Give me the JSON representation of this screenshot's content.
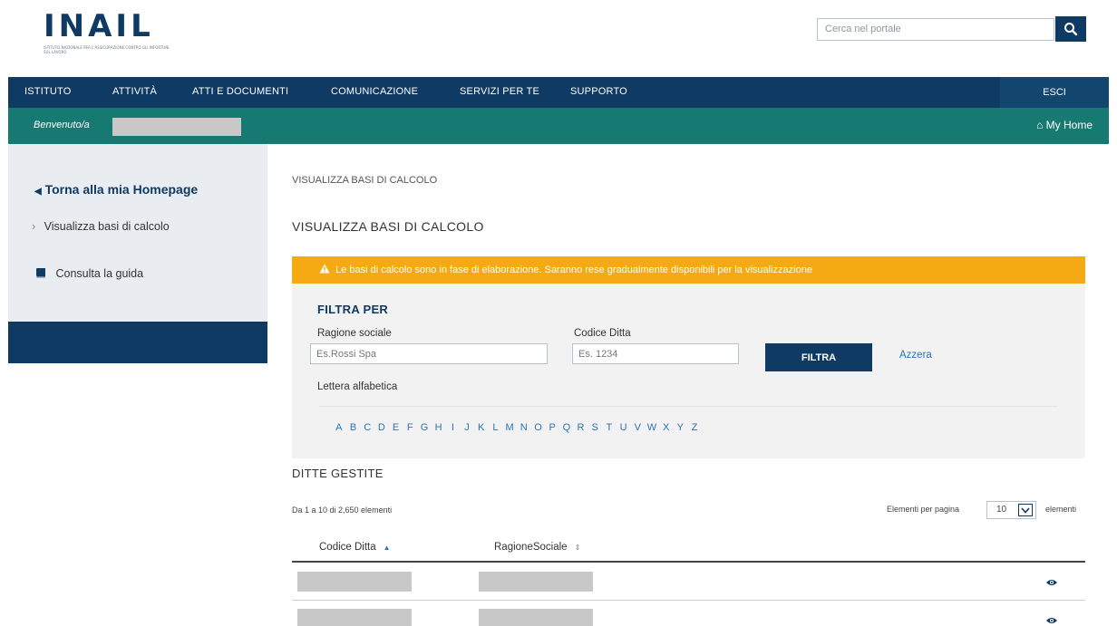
{
  "header": {
    "logo_text": "INAIL",
    "logo_subtitle": "ISTITUTO NAZIONALE PER L'ASSICURAZIONE CONTRO GLI INFORTUNI SUL LAVORO",
    "search_placeholder": "Cerca nel portale"
  },
  "topnav": {
    "items": [
      "ISTITUTO",
      "ATTIVITÀ",
      "ATTI E DOCUMENTI",
      "COMUNICAZIONE",
      "SERVIZI PER TE",
      "SUPPORTO"
    ],
    "logout": "ESCI"
  },
  "welcome": {
    "label": "Benvenuto/a",
    "my_home": "My Home"
  },
  "sidebar": {
    "back_link": "Torna alla mia Homepage",
    "item": "Visualizza basi di calcolo",
    "guide": "Consulta la guida"
  },
  "main": {
    "breadcrumb": "VISUALIZZA BASI DI CALCOLO",
    "title": "VISUALIZZA BASI DI CALCOLO",
    "alert": "Le basi di calcolo sono in fase di elaborazione. Saranno rese gradualmente disponibili per la visualizzazione",
    "filter": {
      "title": "FILTRA PER",
      "ragione_label": "Ragione sociale",
      "ragione_placeholder": "Es.Rossi Spa",
      "codice_label": "Codice Ditta",
      "codice_placeholder": "Es. 1234",
      "filter_button": "FILTRA",
      "reset_link": "Azzera",
      "alpha_label": "Lettera alfabetica",
      "letters": [
        "A",
        "B",
        "C",
        "D",
        "E",
        "F",
        "G",
        "H",
        "I",
        "J",
        "K",
        "L",
        "M",
        "N",
        "O",
        "P",
        "Q",
        "R",
        "S",
        "T",
        "U",
        "V",
        "W",
        "X",
        "Y",
        "Z"
      ]
    },
    "ditte": {
      "title": "DITTE GESTITE",
      "count_text": "Da 1 a 10 di 2,650 elementi",
      "per_page_label": "Elementi per pagina",
      "per_page_value": "10",
      "per_page_suffix": "elementi",
      "columns": [
        "Codice Ditta",
        "RagioneSociale"
      ]
    }
  },
  "colors": {
    "primary": "#0e3a63",
    "teal": "#177a72",
    "alert": "#f5a913",
    "link": "#2a74b8"
  }
}
